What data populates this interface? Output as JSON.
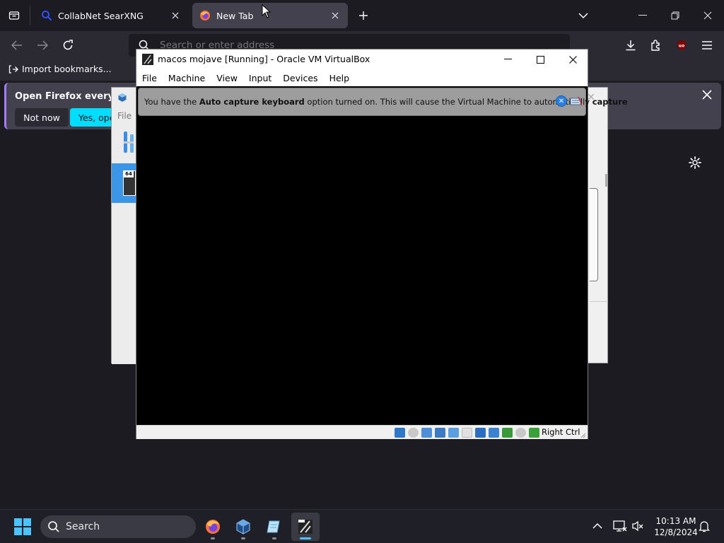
{
  "browser": {
    "tabs": [
      {
        "title": "CollabNet SearXNG"
      },
      {
        "title": "New Tab"
      }
    ],
    "urlbar": {
      "placeholder": "Search or enter address"
    },
    "bookmarks": {
      "import_label": "Import bookmarks..."
    },
    "notification": {
      "text": "Open Firefox every time",
      "not_now": "Not now",
      "yes": "Yes, open"
    },
    "colors": {
      "accent": "#00ddff",
      "tab_active": "#42414d",
      "toolbar": "#2b2a33"
    }
  },
  "vbox_manager": {
    "menu_first": "File",
    "vm_badge": "64"
  },
  "vm_window": {
    "title": "macos mojave [Running] - Oracle VM VirtualBox",
    "menu": [
      "File",
      "Machine",
      "View",
      "Input",
      "Devices",
      "Help"
    ],
    "banner": {
      "prefix": "You have the ",
      "bold1": "Auto capture keyboard",
      "middle": " option turned on. This will cause the Virtual Machine to automatically ",
      "bold2": "capture"
    },
    "host_key": "Right Ctrl",
    "status_icons": [
      "hard-disk",
      "optical-drive",
      "audio",
      "network",
      "usb",
      "shared-folders",
      "display",
      "video-capture",
      "recording",
      "mouse-integration",
      "keyboard-capture",
      "cpu"
    ]
  },
  "taskbar": {
    "search_label": "Search",
    "apps": [
      "firefox",
      "virtualbox",
      "notepad",
      "virtualbox-vm"
    ],
    "clock": {
      "time": "10:13 AM",
      "date": "12/8/2024"
    }
  }
}
